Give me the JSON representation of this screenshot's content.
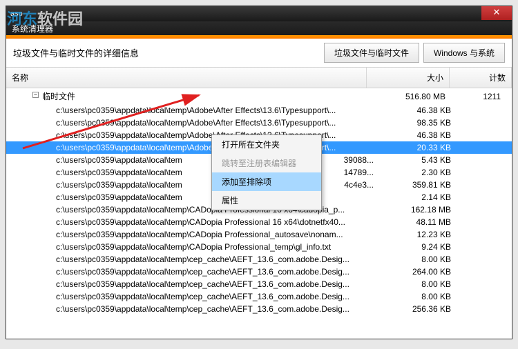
{
  "titlebar": {
    "app": "aso",
    "subtitle": "系统清理器",
    "close": "✕"
  },
  "watermark": {
    "prefix": "河东",
    "suffix": "软件园"
  },
  "header": {
    "label": "垃圾文件与临时文件的详细信息",
    "btn_junk": "垃圾文件与临时文件",
    "btn_win": "Windows 与系统"
  },
  "columns": {
    "name": "名称",
    "size": "大小",
    "count": "计数"
  },
  "group": {
    "label": "临时文件",
    "size": "516.80 MB",
    "count": "1211",
    "toggle": "−"
  },
  "rows": [
    {
      "path": "c:\\users\\pc0359\\appdata\\local\\temp\\Adobe\\After Effects\\13.6\\Typesupport\\...",
      "size": "46.38 KB"
    },
    {
      "path": "c:\\users\\pc0359\\appdata\\local\\temp\\Adobe\\After Effects\\13.6\\Typesupport\\...",
      "size": "98.35 KB"
    },
    {
      "path": "c:\\users\\pc0359\\appdata\\local\\temp\\Adobe\\After Effects\\13.6\\Typesupport\\...",
      "size": "46.38 KB"
    },
    {
      "path": "c:\\users\\pc0359\\appdata\\local\\temp\\Adobe\\After Effects\\13.6\\Typesupport\\...",
      "size": "20.33 KB",
      "selected": true
    },
    {
      "path": "c:\\users\\pc0359\\appdata\\local\\tem",
      "tail": "39088...",
      "size": "5.43 KB"
    },
    {
      "path": "c:\\users\\pc0359\\appdata\\local\\tem",
      "tail": "14789...",
      "size": "2.30 KB"
    },
    {
      "path": "c:\\users\\pc0359\\appdata\\local\\tem",
      "tail": "4c4e3...",
      "size": "359.81 KB"
    },
    {
      "path": "c:\\users\\pc0359\\appdata\\local\\tem",
      "tail": "",
      "size": "2.14 KB"
    },
    {
      "path": "c:\\users\\pc0359\\appdata\\local\\temp\\CADopia Professional 16 x64\\cadopia_p...",
      "size": "162.18 MB"
    },
    {
      "path": "c:\\users\\pc0359\\appdata\\local\\temp\\CADopia Professional 16 x64\\dotnetfx40...",
      "size": "48.11 MB"
    },
    {
      "path": "c:\\users\\pc0359\\appdata\\local\\temp\\CADopia Professional_autosave\\nonam...",
      "size": "12.23 KB"
    },
    {
      "path": "c:\\users\\pc0359\\appdata\\local\\temp\\CADopia Professional_temp\\gl_info.txt",
      "size": "9.24 KB"
    },
    {
      "path": "c:\\users\\pc0359\\appdata\\local\\temp\\cep_cache\\AEFT_13.6_com.adobe.Desig...",
      "size": "8.00 KB"
    },
    {
      "path": "c:\\users\\pc0359\\appdata\\local\\temp\\cep_cache\\AEFT_13.6_com.adobe.Desig...",
      "size": "264.00 KB"
    },
    {
      "path": "c:\\users\\pc0359\\appdata\\local\\temp\\cep_cache\\AEFT_13.6_com.adobe.Desig...",
      "size": "8.00 KB"
    },
    {
      "path": "c:\\users\\pc0359\\appdata\\local\\temp\\cep_cache\\AEFT_13.6_com.adobe.Desig...",
      "size": "8.00 KB"
    },
    {
      "path": "c:\\users\\pc0359\\appdata\\local\\temp\\cep_cache\\AEFT_13.6_com.adobe.Desig...",
      "size": "256.36 KB"
    }
  ],
  "context_menu": {
    "open_folder": "打开所在文件夹",
    "jump_regedit": "跳转至注册表编辑器",
    "add_exclude": "添加至排除项",
    "properties": "属性"
  }
}
